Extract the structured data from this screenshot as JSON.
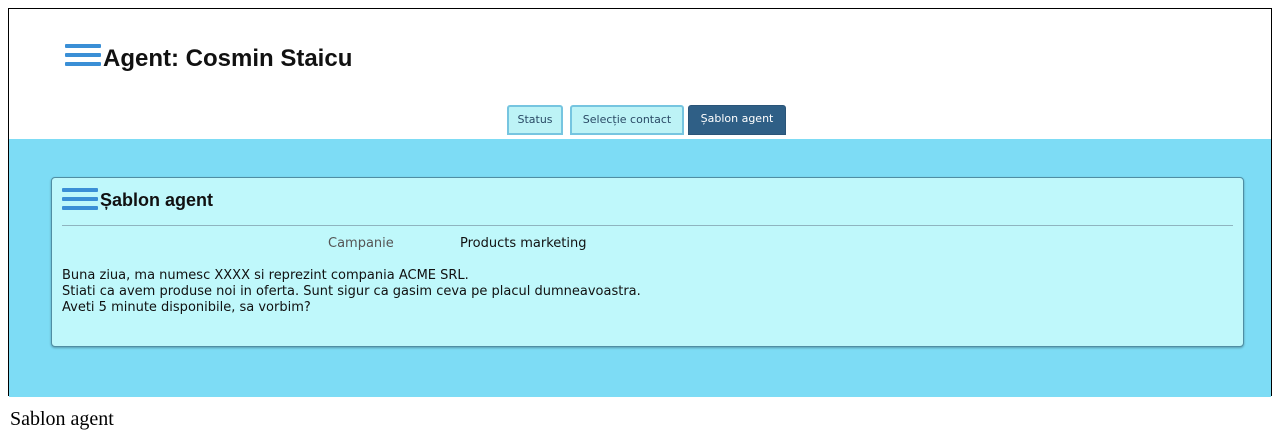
{
  "header": {
    "menu_icon": "hamburger-menu-icon",
    "title": "Agent: Cosmin Staicu"
  },
  "tabs": [
    {
      "label": "Status",
      "active": false
    },
    {
      "label": "Selecție contact",
      "active": false
    },
    {
      "label": "Șablon agent",
      "active": true
    }
  ],
  "panel": {
    "menu_icon": "hamburger-menu-icon",
    "title": "Șablon agent",
    "campaign_label": "Campanie",
    "campaign_value": "Products marketing",
    "message_lines": [
      "Buna ziua, ma numesc XXXX si reprezint compania ACME SRL.",
      "Stiati ca avem produse noi in oferta. Sunt sigur ca gasim ceva pe placul dumneavoastra.",
      "Aveti 5 minute disponibile, sa vorbim?"
    ]
  },
  "caption": "Sablon agent",
  "colors": {
    "accent_icon": "#3a8fd6",
    "content_bg": "#7ddcf5",
    "panel_bg": "#bff8fb",
    "tab_active_bg": "#2f5f86",
    "tab_inactive_bg": "#bdf3f6"
  }
}
